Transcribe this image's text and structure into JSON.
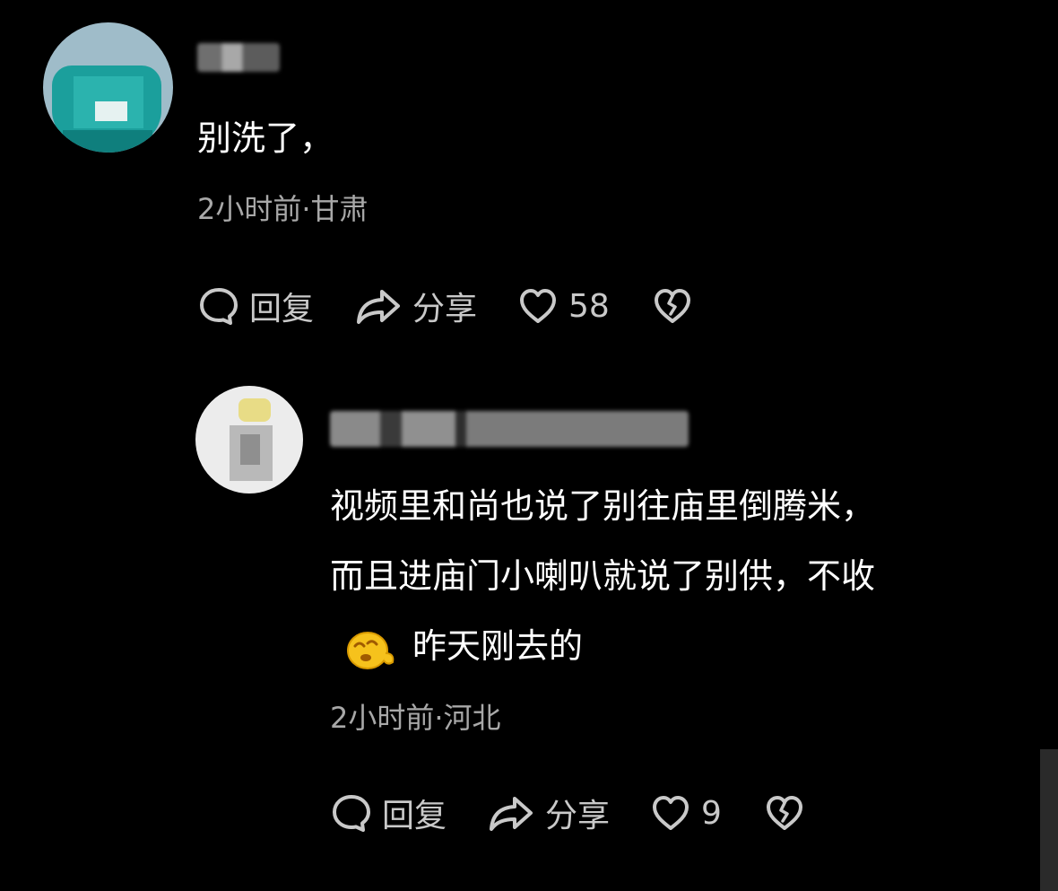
{
  "comments": [
    {
      "text": "别洗了，",
      "meta": "2小时前·甘肃",
      "actions": {
        "reply_label": "回复",
        "share_label": "分享",
        "like_count": "58"
      }
    },
    {
      "text_line1": "视频里和尚也说了别往庙里倒腾米，",
      "text_line2": "而且进庙门小喇叭就说了别供，不收",
      "text_line3": "昨天刚去的",
      "meta": "2小时前·河北",
      "actions": {
        "reply_label": "回复",
        "share_label": "分享",
        "like_count": "9"
      }
    }
  ],
  "icons": {
    "reply": "speech-bubble-icon",
    "share": "share-arrow-icon",
    "like": "heart-icon",
    "dislike": "broken-heart-icon",
    "emoji": "dizzy-sleepy-face-emoji"
  },
  "colors": {
    "background": "#000000",
    "text_primary": "#ffffff",
    "text_secondary": "#a8a8a8",
    "action_color": "#c9c9c9"
  }
}
